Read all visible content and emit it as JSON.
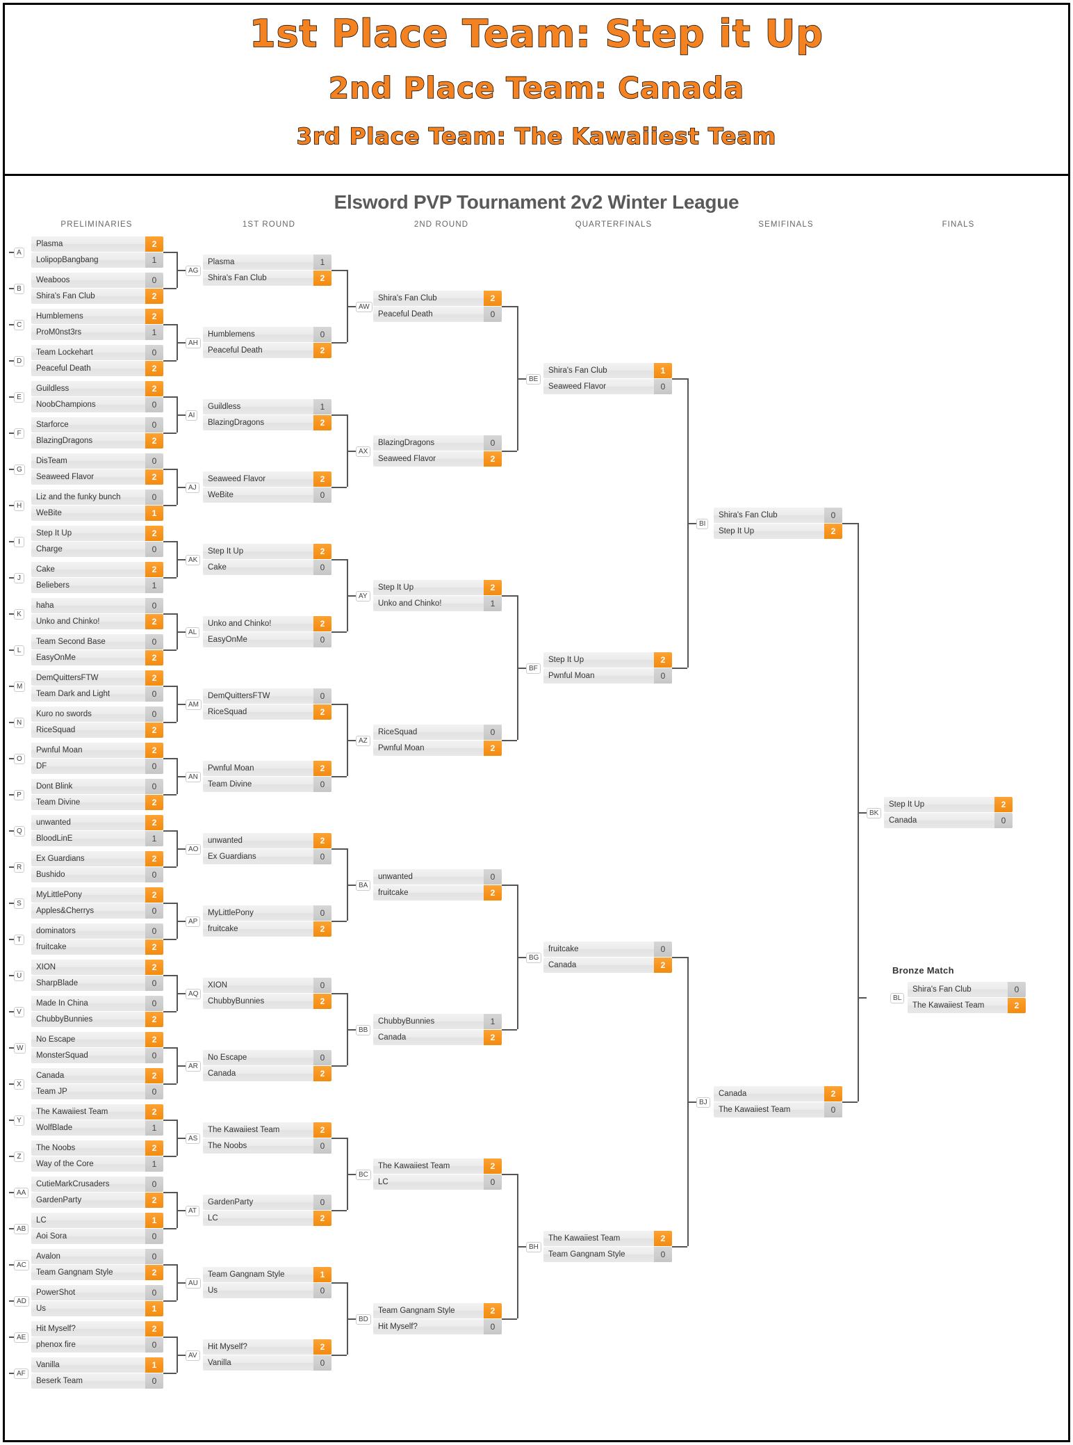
{
  "banner": {
    "place1": "1st Place Team: Step it Up",
    "place2": "2nd Place Team: Canada",
    "place3": "3rd Place Team: The Kawaiiest Team",
    "accent_color": "#F58220"
  },
  "chart_title": "Elsword PVP Tournament 2v2 Winter League",
  "bronze_title": "Bronze Match",
  "round_labels": [
    "PRELIMINARIES",
    "1ST ROUND",
    "2ND ROUND",
    "QUARTERFINALS",
    "SEMIFINALS",
    "FINALS"
  ],
  "chart_data": {
    "type": "table",
    "title": "Elsword PVP Tournament 2v2 Winter League",
    "rounds": [
      {
        "name": "PRELIMINARIES",
        "matches": [
          {
            "id": "A",
            "teams": [
              "Plasma",
              "LolipopBangbang"
            ],
            "scores": [
              "2",
              "1"
            ],
            "winner": 0
          },
          {
            "id": "B",
            "teams": [
              "Weaboos",
              "Shira's Fan Club"
            ],
            "scores": [
              "0",
              "2"
            ],
            "winner": 1
          },
          {
            "id": "C",
            "teams": [
              "Humblemens",
              "ProM0nst3rs"
            ],
            "scores": [
              "2",
              "1"
            ],
            "winner": 0
          },
          {
            "id": "D",
            "teams": [
              "Team Lockehart",
              "Peaceful Death"
            ],
            "scores": [
              "0",
              "2"
            ],
            "winner": 1
          },
          {
            "id": "E",
            "teams": [
              "Guildless",
              "NoobChampions"
            ],
            "scores": [
              "2",
              "0"
            ],
            "winner": 0
          },
          {
            "id": "F",
            "teams": [
              "Starforce",
              "BlazingDragons"
            ],
            "scores": [
              "0",
              "2"
            ],
            "winner": 1
          },
          {
            "id": "G",
            "teams": [
              "DisTeam",
              "Seaweed Flavor"
            ],
            "scores": [
              "0",
              "2"
            ],
            "winner": 1
          },
          {
            "id": "H",
            "teams": [
              "Liz and the funky bunch",
              "WeBite"
            ],
            "scores": [
              "0",
              "1"
            ],
            "winner": 1
          },
          {
            "id": "I",
            "teams": [
              "Step It Up",
              "Charge"
            ],
            "scores": [
              "2",
              "0"
            ],
            "winner": 0
          },
          {
            "id": "J",
            "teams": [
              "Cake",
              "Beliebers"
            ],
            "scores": [
              "2",
              "1"
            ],
            "winner": 0
          },
          {
            "id": "K",
            "teams": [
              "haha",
              "Unko and Chinko!"
            ],
            "scores": [
              "0",
              "2"
            ],
            "winner": 1
          },
          {
            "id": "L",
            "teams": [
              "Team Second Base",
              "EasyOnMe"
            ],
            "scores": [
              "0",
              "2"
            ],
            "winner": 1
          },
          {
            "id": "M",
            "teams": [
              "DemQuittersFTW",
              "Team Dark and Light"
            ],
            "scores": [
              "2",
              "0"
            ],
            "winner": 0
          },
          {
            "id": "N",
            "teams": [
              "Kuro no swords",
              "RiceSquad"
            ],
            "scores": [
              "0",
              "2"
            ],
            "winner": 1
          },
          {
            "id": "O",
            "teams": [
              "Pwnful Moan",
              "DF"
            ],
            "scores": [
              "2",
              "0"
            ],
            "winner": 0
          },
          {
            "id": "P",
            "teams": [
              "Dont Blink",
              "Team Divine"
            ],
            "scores": [
              "0",
              "2"
            ],
            "winner": 1
          },
          {
            "id": "Q",
            "teams": [
              "unwanted",
              "BloodLinE"
            ],
            "scores": [
              "2",
              "1"
            ],
            "winner": 0
          },
          {
            "id": "R",
            "teams": [
              "Ex Guardians",
              "Bushido"
            ],
            "scores": [
              "2",
              "0"
            ],
            "winner": 0
          },
          {
            "id": "S",
            "teams": [
              "MyLittlePony",
              "Apples&Cherrys"
            ],
            "scores": [
              "2",
              "0"
            ],
            "winner": 0
          },
          {
            "id": "T",
            "teams": [
              "dominators",
              "fruitcake"
            ],
            "scores": [
              "0",
              "2"
            ],
            "winner": 1
          },
          {
            "id": "U",
            "teams": [
              "XION",
              "SharpBlade"
            ],
            "scores": [
              "2",
              "0"
            ],
            "winner": 0
          },
          {
            "id": "V",
            "teams": [
              "Made In China",
              "ChubbyBunnies"
            ],
            "scores": [
              "0",
              "2"
            ],
            "winner": 1
          },
          {
            "id": "W",
            "teams": [
              "No Escape",
              "MonsterSquad"
            ],
            "scores": [
              "2",
              "0"
            ],
            "winner": 0
          },
          {
            "id": "X",
            "teams": [
              "Canada",
              "Team JP"
            ],
            "scores": [
              "2",
              "0"
            ],
            "winner": 0
          },
          {
            "id": "Y",
            "teams": [
              "The Kawaiiest Team",
              "WolfBlade"
            ],
            "scores": [
              "2",
              "1"
            ],
            "winner": 0
          },
          {
            "id": "Z",
            "teams": [
              "The Noobs",
              "Way of the Core"
            ],
            "scores": [
              "2",
              "1"
            ],
            "winner": 0
          },
          {
            "id": "AA",
            "teams": [
              "CutieMarkCrusaders",
              "GardenParty"
            ],
            "scores": [
              "0",
              "2"
            ],
            "winner": 1
          },
          {
            "id": "AB",
            "teams": [
              "LC",
              "Aoi Sora"
            ],
            "scores": [
              "1",
              "0"
            ],
            "winner": 0
          },
          {
            "id": "AC",
            "teams": [
              "Avalon",
              "Team Gangnam Style"
            ],
            "scores": [
              "0",
              "2"
            ],
            "winner": 1
          },
          {
            "id": "AD",
            "teams": [
              "PowerShot",
              "Us"
            ],
            "scores": [
              "0",
              "1"
            ],
            "winner": 1
          },
          {
            "id": "AE",
            "teams": [
              "Hit Myself?",
              "phenox fire"
            ],
            "scores": [
              "2",
              "0"
            ],
            "winner": 0
          },
          {
            "id": "AF",
            "teams": [
              "Vanilla",
              "Beserk Team"
            ],
            "scores": [
              "1",
              "0"
            ],
            "winner": 0
          }
        ]
      },
      {
        "name": "1ST ROUND",
        "matches": [
          {
            "id": "AG",
            "teams": [
              "Plasma",
              "Shira's Fan Club"
            ],
            "scores": [
              "1",
              "2"
            ],
            "winner": 1
          },
          {
            "id": "AH",
            "teams": [
              "Humblemens",
              "Peaceful Death"
            ],
            "scores": [
              "0",
              "2"
            ],
            "winner": 1
          },
          {
            "id": "AI",
            "teams": [
              "Guildless",
              "BlazingDragons"
            ],
            "scores": [
              "1",
              "2"
            ],
            "winner": 1
          },
          {
            "id": "AJ",
            "teams": [
              "Seaweed Flavor",
              "WeBite"
            ],
            "scores": [
              "2",
              "0"
            ],
            "winner": 0
          },
          {
            "id": "AK",
            "teams": [
              "Step It Up",
              "Cake"
            ],
            "scores": [
              "2",
              "0"
            ],
            "winner": 0
          },
          {
            "id": "AL",
            "teams": [
              "Unko and Chinko!",
              "EasyOnMe"
            ],
            "scores": [
              "2",
              "0"
            ],
            "winner": 0
          },
          {
            "id": "AM",
            "teams": [
              "DemQuittersFTW",
              "RiceSquad"
            ],
            "scores": [
              "0",
              "2"
            ],
            "winner": 1
          },
          {
            "id": "AN",
            "teams": [
              "Pwnful Moan",
              "Team Divine"
            ],
            "scores": [
              "2",
              "0"
            ],
            "winner": 0
          },
          {
            "id": "AO",
            "teams": [
              "unwanted",
              "Ex Guardians"
            ],
            "scores": [
              "2",
              "0"
            ],
            "winner": 0
          },
          {
            "id": "AP",
            "teams": [
              "MyLittlePony",
              "fruitcake"
            ],
            "scores": [
              "0",
              "2"
            ],
            "winner": 1
          },
          {
            "id": "AQ",
            "teams": [
              "XION",
              "ChubbyBunnies"
            ],
            "scores": [
              "0",
              "2"
            ],
            "winner": 1
          },
          {
            "id": "AR",
            "teams": [
              "No Escape",
              "Canada"
            ],
            "scores": [
              "0",
              "2"
            ],
            "winner": 1
          },
          {
            "id": "AS",
            "teams": [
              "The Kawaiiest Team",
              "The Noobs"
            ],
            "scores": [
              "2",
              "0"
            ],
            "winner": 0
          },
          {
            "id": "AT",
            "teams": [
              "GardenParty",
              "LC"
            ],
            "scores": [
              "0",
              "2"
            ],
            "winner": 1
          },
          {
            "id": "AU",
            "teams": [
              "Team Gangnam Style",
              "Us"
            ],
            "scores": [
              "1",
              "0"
            ],
            "winner": 0
          },
          {
            "id": "AV",
            "teams": [
              "Hit Myself?",
              "Vanilla"
            ],
            "scores": [
              "2",
              "0"
            ],
            "winner": 0
          }
        ]
      },
      {
        "name": "2ND ROUND",
        "matches": [
          {
            "id": "AW",
            "teams": [
              "Shira's Fan Club",
              "Peaceful Death"
            ],
            "scores": [
              "2",
              "0"
            ],
            "winner": 0
          },
          {
            "id": "AX",
            "teams": [
              "BlazingDragons",
              "Seaweed Flavor"
            ],
            "scores": [
              "0",
              "2"
            ],
            "winner": 1
          },
          {
            "id": "AY",
            "teams": [
              "Step It Up",
              "Unko and Chinko!"
            ],
            "scores": [
              "2",
              "1"
            ],
            "winner": 0
          },
          {
            "id": "AZ",
            "teams": [
              "RiceSquad",
              "Pwnful Moan"
            ],
            "scores": [
              "0",
              "2"
            ],
            "winner": 1
          },
          {
            "id": "BA",
            "teams": [
              "unwanted",
              "fruitcake"
            ],
            "scores": [
              "0",
              "2"
            ],
            "winner": 1
          },
          {
            "id": "BB",
            "teams": [
              "ChubbyBunnies",
              "Canada"
            ],
            "scores": [
              "1",
              "2"
            ],
            "winner": 1
          },
          {
            "id": "BC",
            "teams": [
              "The Kawaiiest Team",
              "LC"
            ],
            "scores": [
              "2",
              "0"
            ],
            "winner": 0
          },
          {
            "id": "BD",
            "teams": [
              "Team Gangnam Style",
              "Hit Myself?"
            ],
            "scores": [
              "2",
              "0"
            ],
            "winner": 0
          }
        ]
      },
      {
        "name": "QUARTERFINALS",
        "matches": [
          {
            "id": "BE",
            "teams": [
              "Shira's Fan Club",
              "Seaweed Flavor"
            ],
            "scores": [
              "1",
              "0"
            ],
            "winner": 0
          },
          {
            "id": "BF",
            "teams": [
              "Step It Up",
              "Pwnful Moan"
            ],
            "scores": [
              "2",
              "0"
            ],
            "winner": 0
          },
          {
            "id": "BG",
            "teams": [
              "fruitcake",
              "Canada"
            ],
            "scores": [
              "0",
              "2"
            ],
            "winner": 1
          },
          {
            "id": "BH",
            "teams": [
              "The Kawaiiest Team",
              "Team Gangnam Style"
            ],
            "scores": [
              "2",
              "0"
            ],
            "winner": 0
          }
        ]
      },
      {
        "name": "SEMIFINALS",
        "matches": [
          {
            "id": "BI",
            "teams": [
              "Shira's Fan Club",
              "Step It Up"
            ],
            "scores": [
              "0",
              "2"
            ],
            "winner": 1
          },
          {
            "id": "BJ",
            "teams": [
              "Canada",
              "The Kawaiiest Team"
            ],
            "scores": [
              "2",
              "0"
            ],
            "winner": 0
          }
        ]
      },
      {
        "name": "FINALS",
        "matches": [
          {
            "id": "BK",
            "teams": [
              "Step It Up",
              "Canada"
            ],
            "scores": [
              "2",
              "0"
            ],
            "winner": 0
          }
        ]
      },
      {
        "name": "Bronze Match",
        "matches": [
          {
            "id": "BL",
            "teams": [
              "Shira's Fan Club",
              "The Kawaiiest Team"
            ],
            "scores": [
              "0",
              "2"
            ],
            "winner": 1
          }
        ]
      }
    ]
  }
}
